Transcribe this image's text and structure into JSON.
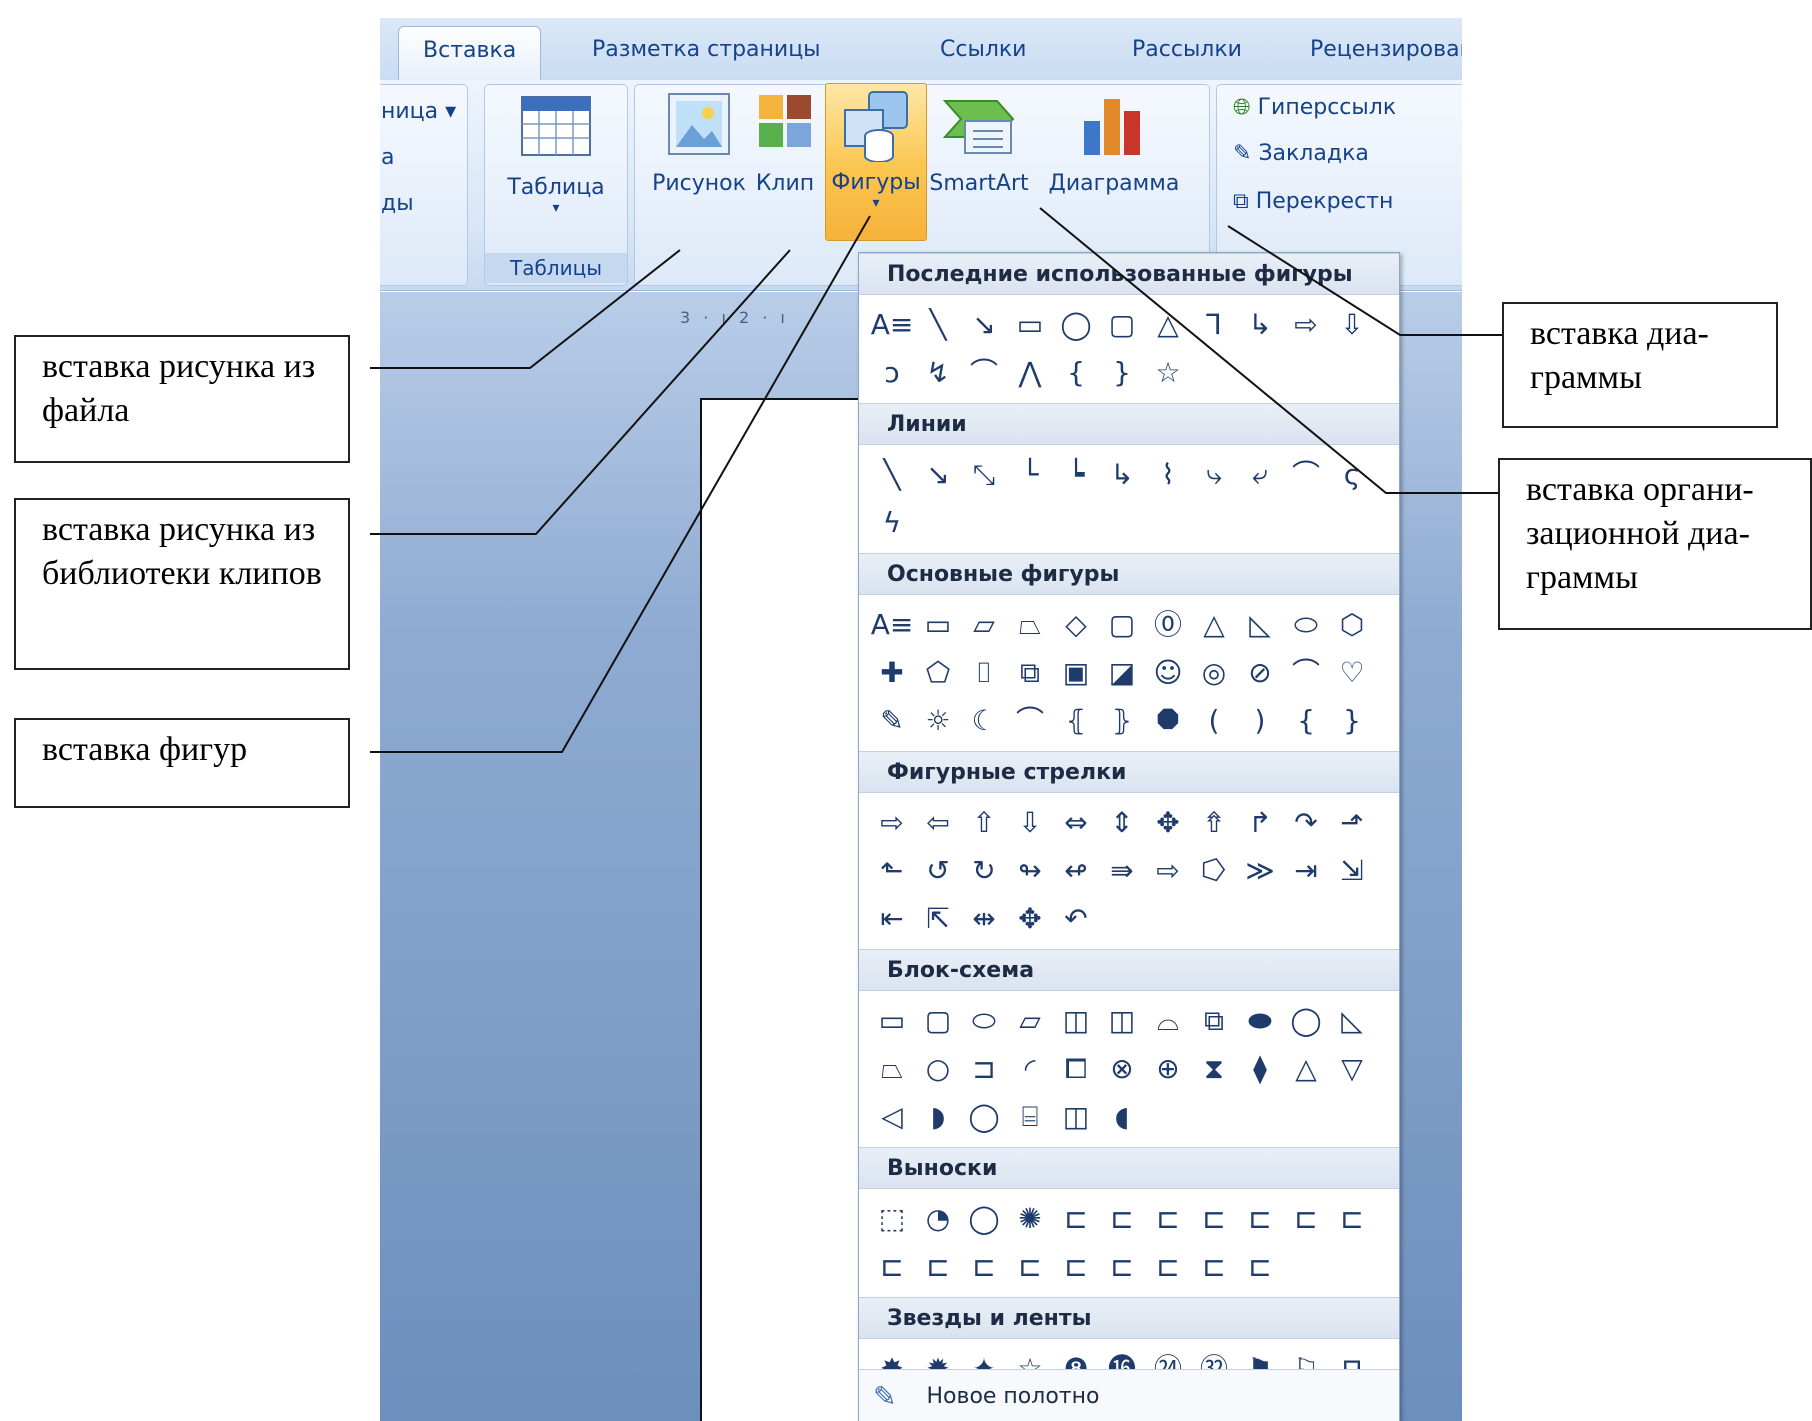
{
  "ribbon": {
    "tabs": [
      "Вставка",
      "Разметка страницы",
      "Ссылки",
      "Рассылки",
      "Рецензировани"
    ],
    "partial_items": [
      "ница",
      "а",
      "ды"
    ],
    "groups": {
      "tables": {
        "button": "Таблица",
        "label": "Таблицы"
      },
      "illustrations": {
        "picture": "Рисунок",
        "clip": "Клип",
        "shapes": "Фигуры",
        "smartart": "SmartArt",
        "chart": "Диаграмма"
      },
      "links": {
        "hyperlink": "Гиперссылк",
        "bookmark": "Закладка",
        "crossref": "Перекрестн"
      }
    }
  },
  "ruler_text": "3 · ı 2 · ı",
  "dropdown": {
    "sections": [
      {
        "title": "Последние использованные фигуры",
        "shapes": [
          "A≡",
          "╲",
          "↘",
          "▭",
          "◯",
          "▢",
          "△",
          "⅂",
          "↳",
          "⇨",
          "⇩",
          "ↄ",
          "↯",
          "⌒",
          "⋀",
          "{",
          "}",
          "☆"
        ]
      },
      {
        "title": "Линии",
        "shapes": [
          "╲",
          "↘",
          "⤡",
          "└",
          "┕",
          "↳",
          "⌇",
          "⤷",
          "⤶",
          "⌒",
          "ς",
          "ϟ"
        ]
      },
      {
        "title": "Основные фигуры",
        "shapes": [
          "A≡",
          "▭",
          "▱",
          "⏢",
          "◇",
          "▢",
          "⓪",
          "△",
          "◺",
          "⬭",
          "⬡",
          "✚",
          "⬠",
          "⌷",
          "⧉",
          "▣",
          "◪",
          "☺",
          "◎",
          "⊘",
          "⌒",
          "♡",
          "✎",
          "☼",
          "☾",
          "⌒",
          "⦃",
          "⦄",
          "⯃",
          "(",
          ")",
          "{",
          "}"
        ]
      },
      {
        "title": "Фигурные стрелки",
        "shapes": [
          "⇨",
          "⇦",
          "⇧",
          "⇩",
          "⇔",
          "⇕",
          "✥",
          "⇮",
          "↱",
          "↷",
          "⬏",
          "⬑",
          "↺",
          "↻",
          "↬",
          "↫",
          "⇛",
          "⇨",
          "⭔",
          "≫",
          "⇥",
          "⇲",
          "⇤",
          "⇱",
          "⇹",
          "✥",
          "↶"
        ]
      },
      {
        "title": "Блок-схема",
        "shapes": [
          "▭",
          "▢",
          "⬭",
          "▱",
          "◫",
          "◫",
          "⌓",
          "⧉",
          "⬬",
          "◯",
          "◺",
          "⏢",
          "○",
          "⊐",
          "◜",
          "⧠",
          "⊗",
          "⊕",
          "⧗",
          "⧫",
          "△",
          "▽",
          "◁",
          "◗",
          "◯",
          "⌸",
          "◫",
          "◖"
        ]
      },
      {
        "title": "Выноски",
        "shapes": [
          "⬚",
          "◔",
          "◯",
          "✺",
          "⊏",
          "⊏",
          "⊏",
          "⊏",
          "⊏",
          "⊏",
          "⊏",
          "⊏",
          "⊏",
          "⊏",
          "⊏",
          "⊏",
          "⊏",
          "⊏",
          "⊏",
          "⊏"
        ]
      },
      {
        "title": "Звезды и ленты",
        "shapes": [
          "✸",
          "✹",
          "✦",
          "☆",
          "❽",
          "⓰",
          "㉔",
          "㉜",
          "⚑",
          "⚐",
          "⊓",
          "⊔",
          "⌷",
          "⊏",
          "∿",
          "∾"
        ]
      }
    ],
    "footer": "Новое полотно"
  },
  "callouts": {
    "file_picture": "вставка рисунка из файла",
    "clip_library": "вставка рисунка из библиотеки клипов",
    "shapes": "вставка фигур",
    "chart": "вставка диа-граммы",
    "org_chart": "вставка органи-зационной диа-граммы"
  },
  "colors": {
    "ribbon_text": "#15428b",
    "active_button": "#fbc54e",
    "workspace": "#8fabd2"
  }
}
